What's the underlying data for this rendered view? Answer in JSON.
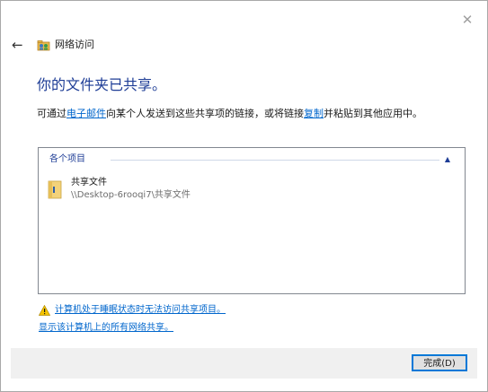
{
  "window": {
    "close_glyph": "✕",
    "back_glyph": "←",
    "title": "网络访问"
  },
  "heading": "你的文件夹已共享。",
  "description": {
    "part1": "可通过",
    "email_link": "电子邮件",
    "part2": "向某个人发送到这些共享项的链接，或将链接",
    "copy_link": "复制",
    "part3": "并粘贴到其他应用中。"
  },
  "list": {
    "group_label": "各个项目",
    "collapse_glyph": "▲",
    "items": [
      {
        "name": "共享文件",
        "path": "\\\\Desktop-6rooqi7\\共享文件",
        "icon": "folder-icon"
      }
    ]
  },
  "warning": {
    "icon": "warning-icon",
    "text": "计算机处于睡眠状态时无法访问共享项目。"
  },
  "show_all_link": "显示该计算机上的所有网络共享。",
  "footer": {
    "finish_label": "完成(D)"
  },
  "colors": {
    "heading": "#1e3d96",
    "link": "#0066cc",
    "footer_bg": "#f0f0f0",
    "button_border": "#0078d7"
  }
}
